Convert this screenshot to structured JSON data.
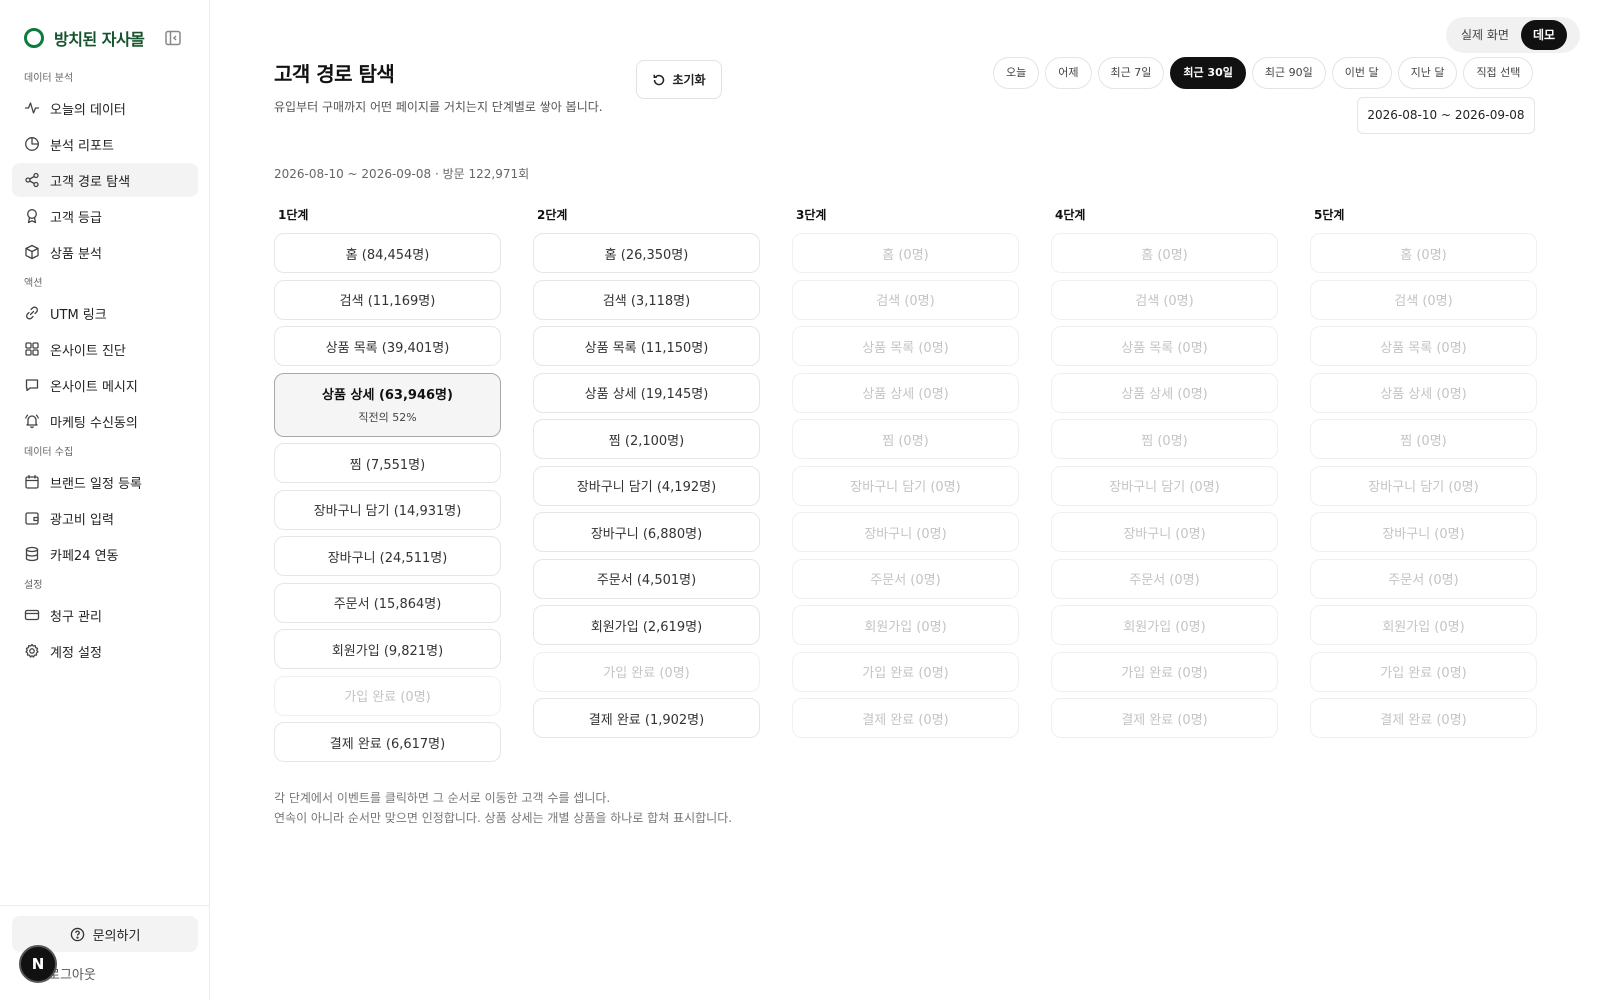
{
  "brand": {
    "name": "방치된 자사몰"
  },
  "nav": {
    "sections": [
      {
        "label": "데이터 분석",
        "items": [
          {
            "label": "오늘의 데이터",
            "icon": "activity-icon",
            "name": "sidebar-item-today-data"
          },
          {
            "label": "분석 리포트",
            "icon": "pie-chart-icon",
            "name": "sidebar-item-report"
          },
          {
            "label": "고객 경로 탐색",
            "icon": "share-icon",
            "name": "sidebar-item-customer-journey",
            "active": true
          },
          {
            "label": "고객 등급",
            "icon": "award-icon",
            "name": "sidebar-item-customer-grade"
          },
          {
            "label": "상품 분석",
            "icon": "box-icon",
            "name": "sidebar-item-product-analysis"
          }
        ]
      },
      {
        "label": "액션",
        "items": [
          {
            "label": "UTM 링크",
            "icon": "link-icon",
            "name": "sidebar-item-utm-link"
          },
          {
            "label": "온사이트 진단",
            "icon": "grid-icon",
            "name": "sidebar-item-onsite-diagnosis"
          },
          {
            "label": "온사이트 메시지",
            "icon": "message-icon",
            "name": "sidebar-item-onsite-message"
          },
          {
            "label": "마케팅 수신동의",
            "icon": "bell-icon",
            "name": "sidebar-item-marketing-consent"
          }
        ]
      },
      {
        "label": "데이터 수집",
        "items": [
          {
            "label": "브랜드 일정 등록",
            "icon": "calendar-icon",
            "name": "sidebar-item-brand-schedule"
          },
          {
            "label": "광고비 입력",
            "icon": "wallet-icon",
            "name": "sidebar-item-ad-cost"
          },
          {
            "label": "카페24 연동",
            "icon": "database-icon",
            "name": "sidebar-item-cafe24"
          }
        ]
      },
      {
        "label": "설정",
        "items": [
          {
            "label": "청구 관리",
            "icon": "credit-card-icon",
            "name": "sidebar-item-billing"
          },
          {
            "label": "계정 설정",
            "icon": "gear-icon",
            "name": "sidebar-item-account-settings"
          }
        ]
      }
    ]
  },
  "footer": {
    "help_label": "문의하기",
    "logout_label": "로그아웃",
    "badge": "N"
  },
  "view_toggle": {
    "real": "실제 화면",
    "demo": "데모",
    "selected": "demo"
  },
  "header": {
    "title": "고객 경로 탐색",
    "description": "유입부터 구매까지 어떤 페이지를 거치는지 단계별로 쌓아 봅니다.",
    "reset_label": "초기화"
  },
  "date_ranges": [
    "오늘",
    "어제",
    "최근 7일",
    "최근 30일",
    "최근 90일",
    "이번 달",
    "지난 달",
    "직접 선택"
  ],
  "selected_range": "최근 30일",
  "date_display": "2026-08-10 ~ 2026-09-08",
  "summary": "2026-08-10 ~ 2026-09-08 · 방문 122,971회",
  "steps": [
    {
      "title": "1단계",
      "nodes": [
        {
          "label": "홈 (84,454명)"
        },
        {
          "label": "검색 (11,169명)"
        },
        {
          "label": "상품 목록 (39,401명)"
        },
        {
          "label": "상품 상세 (63,946명)",
          "sub": "직전의 52%",
          "selected": true
        },
        {
          "label": "찜 (7,551명)"
        },
        {
          "label": "장바구니 담기 (14,931명)"
        },
        {
          "label": "장바구니 (24,511명)"
        },
        {
          "label": "주문서 (15,864명)"
        },
        {
          "label": "회원가입 (9,821명)"
        },
        {
          "label": "가입 완료 (0명)",
          "empty": true
        },
        {
          "label": "결제 완료 (6,617명)"
        }
      ]
    },
    {
      "title": "2단계",
      "nodes": [
        {
          "label": "홈 (26,350명)"
        },
        {
          "label": "검색 (3,118명)"
        },
        {
          "label": "상품 목록 (11,150명)"
        },
        {
          "label": "상품 상세 (19,145명)"
        },
        {
          "label": "찜 (2,100명)"
        },
        {
          "label": "장바구니 담기 (4,192명)"
        },
        {
          "label": "장바구니 (6,880명)"
        },
        {
          "label": "주문서 (4,501명)"
        },
        {
          "label": "회원가입 (2,619명)"
        },
        {
          "label": "가입 완료 (0명)",
          "empty": true
        },
        {
          "label": "결제 완료 (1,902명)"
        }
      ]
    },
    {
      "title": "3단계",
      "nodes": [
        {
          "label": "홈 (0명)",
          "empty": true
        },
        {
          "label": "검색 (0명)",
          "empty": true
        },
        {
          "label": "상품 목록 (0명)",
          "empty": true
        },
        {
          "label": "상품 상세 (0명)",
          "empty": true
        },
        {
          "label": "찜 (0명)",
          "empty": true
        },
        {
          "label": "장바구니 담기 (0명)",
          "empty": true
        },
        {
          "label": "장바구니 (0명)",
          "empty": true
        },
        {
          "label": "주문서 (0명)",
          "empty": true
        },
        {
          "label": "회원가입 (0명)",
          "empty": true
        },
        {
          "label": "가입 완료 (0명)",
          "empty": true
        },
        {
          "label": "결제 완료 (0명)",
          "empty": true
        }
      ]
    },
    {
      "title": "4단계",
      "nodes": [
        {
          "label": "홈 (0명)",
          "empty": true
        },
        {
          "label": "검색 (0명)",
          "empty": true
        },
        {
          "label": "상품 목록 (0명)",
          "empty": true
        },
        {
          "label": "상품 상세 (0명)",
          "empty": true
        },
        {
          "label": "찜 (0명)",
          "empty": true
        },
        {
          "label": "장바구니 담기 (0명)",
          "empty": true
        },
        {
          "label": "장바구니 (0명)",
          "empty": true
        },
        {
          "label": "주문서 (0명)",
          "empty": true
        },
        {
          "label": "회원가입 (0명)",
          "empty": true
        },
        {
          "label": "가입 완료 (0명)",
          "empty": true
        },
        {
          "label": "결제 완료 (0명)",
          "empty": true
        }
      ]
    },
    {
      "title": "5단계",
      "nodes": [
        {
          "label": "홈 (0명)",
          "empty": true
        },
        {
          "label": "검색 (0명)",
          "empty": true
        },
        {
          "label": "상품 목록 (0명)",
          "empty": true
        },
        {
          "label": "상품 상세 (0명)",
          "empty": true
        },
        {
          "label": "찜 (0명)",
          "empty": true
        },
        {
          "label": "장바구니 담기 (0명)",
          "empty": true
        },
        {
          "label": "장바구니 (0명)",
          "empty": true
        },
        {
          "label": "주문서 (0명)",
          "empty": true
        },
        {
          "label": "회원가입 (0명)",
          "empty": true
        },
        {
          "label": "가입 완료 (0명)",
          "empty": true
        },
        {
          "label": "결제 완료 (0명)",
          "empty": true
        }
      ]
    }
  ],
  "footnotes": [
    "각 단계에서 이벤트를 클릭하면 그 순서로 이동한 고객 수를 셉니다.",
    "연속이 아니라 순서만 맞으면 인정합니다. 상품 상세는 개별 상품을 하나로 합쳐 표시합니다."
  ],
  "colors": {
    "brand": "#0f7a3d",
    "active_dark": "#111111"
  }
}
